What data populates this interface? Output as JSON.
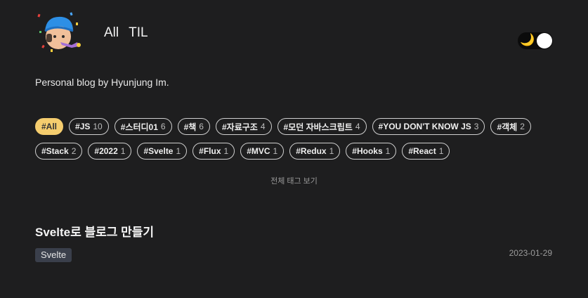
{
  "nav": {
    "items": [
      {
        "label": "All"
      },
      {
        "label": "TIL"
      }
    ]
  },
  "theme_toggle": {
    "icon": "moon-icon",
    "emoji": "🌙"
  },
  "bio": "Personal blog by Hyunjung Im.",
  "tags": [
    {
      "label": "#All",
      "count": "",
      "active": true
    },
    {
      "label": "#JS",
      "count": "10"
    },
    {
      "label": "#스터디01",
      "count": "6"
    },
    {
      "label": "#책",
      "count": "6"
    },
    {
      "label": "#자료구조",
      "count": "4"
    },
    {
      "label": "#모던 자바스크립트",
      "count": "4"
    },
    {
      "label": "#YOU DON'T KNOW JS",
      "count": "3"
    },
    {
      "label": "#객체",
      "count": "2"
    },
    {
      "label": "#Stack",
      "count": "2"
    },
    {
      "label": "#2022",
      "count": "1"
    },
    {
      "label": "#Svelte",
      "count": "1"
    },
    {
      "label": "#Flux",
      "count": "1"
    },
    {
      "label": "#MVC",
      "count": "1"
    },
    {
      "label": "#Redux",
      "count": "1"
    },
    {
      "label": "#Hooks",
      "count": "1"
    },
    {
      "label": "#React",
      "count": "1"
    }
  ],
  "show_all_tags": "전체 태그 보기",
  "post": {
    "title": "Svelte로 블로그 만들기",
    "tag": "Svelte",
    "date": "2023-01-29"
  },
  "colors": {
    "background": "#1e1e1f",
    "active_tag": "#f5cd6e",
    "post_tag_bg": "#3a3f4b"
  }
}
